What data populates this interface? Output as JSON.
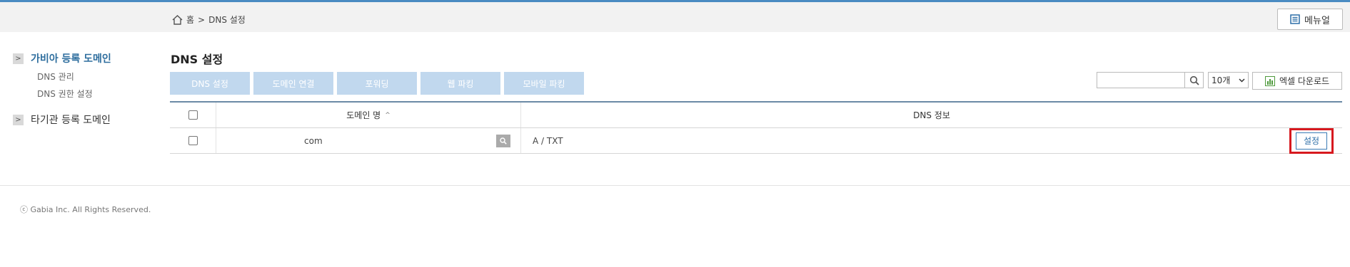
{
  "breadcrumb": {
    "home_icon": "home-icon",
    "home": "홈",
    "separator": ">",
    "current": "DNS 설정"
  },
  "manual_button": {
    "label": "메뉴얼",
    "icon": "document-icon"
  },
  "sidebar": {
    "groups": [
      {
        "label": "가비아 등록 도메인",
        "active": true,
        "items": [
          "DNS 관리",
          "DNS 권한 설정"
        ]
      },
      {
        "label": "타기관 등록 도메인",
        "active": false,
        "items": []
      }
    ]
  },
  "page_title": "DNS 설정",
  "tabs": [
    "DNS 설정",
    "도메인 연결",
    "포워딩",
    "웹 파킹",
    "모바일 파킹"
  ],
  "search": {
    "value": "",
    "placeholder": ""
  },
  "count_select": {
    "value": "10개"
  },
  "excel_button": {
    "label": "엑셀 다운로드",
    "icon": "chart-icon"
  },
  "table": {
    "columns": [
      "도메인 명",
      "DNS 정보"
    ],
    "sort_indicator": "^",
    "rows": [
      {
        "domain": "com",
        "dns_info": "A / TXT",
        "action": "설정"
      }
    ]
  },
  "footer": {
    "copyright": "ⓒ Gabia Inc. All Rights Reserved."
  },
  "colors": {
    "accent": "#2e6e9e",
    "tab_bg": "#c1d8ee",
    "highlight": "#d7191f"
  }
}
